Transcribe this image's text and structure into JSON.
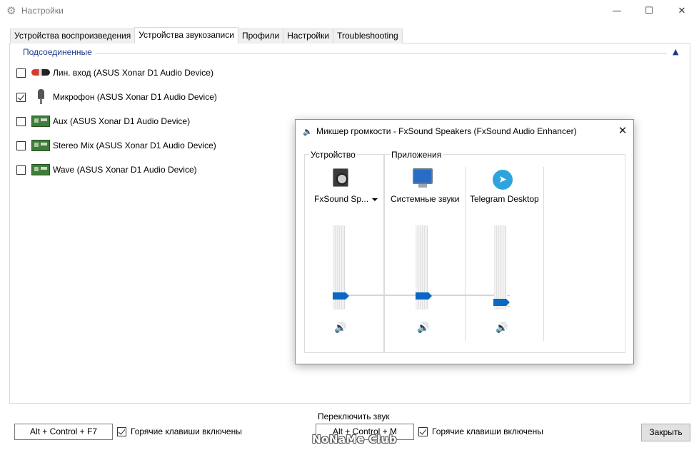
{
  "window": {
    "title": "Настройки",
    "icon": "gear-icon",
    "controls": {
      "minimize": "—",
      "maximize": "☐",
      "close": "✕"
    }
  },
  "tabs": [
    {
      "label": "Устройства воспроизведения",
      "active": false
    },
    {
      "label": "Устройства звукозаписи",
      "active": true
    },
    {
      "label": "Профили",
      "active": false
    },
    {
      "label": "Настройки",
      "active": false
    },
    {
      "label": "Troubleshooting",
      "active": false
    }
  ],
  "devices_group": {
    "header": "Подсоединенные",
    "collapse_glyph": "▲",
    "items": [
      {
        "label": "Лин. вход (ASUS Xonar D1 Audio Device)",
        "checked": false,
        "icon": "line-in-cable-icon"
      },
      {
        "label": "Микрофон (ASUS Xonar D1 Audio Device)",
        "checked": true,
        "icon": "microphone-icon"
      },
      {
        "label": "Aux (ASUS Xonar D1 Audio Device)",
        "checked": false,
        "icon": "sound-card-icon"
      },
      {
        "label": "Stereo Mix (ASUS Xonar D1 Audio Device)",
        "checked": false,
        "icon": "sound-card-icon"
      },
      {
        "label": "Wave (ASUS Xonar D1 Audio Device)",
        "checked": false,
        "icon": "sound-card-icon"
      }
    ]
  },
  "mixer": {
    "title": "Микшер громкости - FxSound Speakers (FxSound Audio Enhancer)",
    "close_glyph": "✕",
    "title_icon_glyph": "🔈",
    "device_group_label": "Устройство",
    "apps_group_label": "Приложения",
    "columns": [
      {
        "label": "FxSound Sp...",
        "icon": "speaker-icon",
        "volume_fraction": 0.3,
        "mute_glyph": "🔊"
      },
      {
        "label": "Системные звуки",
        "icon": "system-sounds-monitor-icon",
        "volume_fraction": 0.3,
        "mute_glyph": "🔊"
      },
      {
        "label": "Telegram Desktop",
        "icon": "telegram-icon",
        "volume_fraction": 0.25,
        "mute_glyph": "🔊"
      }
    ],
    "telegram_glyph": "➤"
  },
  "bottom": {
    "hotkey1": "Alt + Control + F7",
    "hotkeys1_enabled_label": "Горячие клавиши включены",
    "switch_sound_label": "Переключить звук",
    "hotkey2": "Alt + Control + M",
    "hotkeys2_enabled_label": "Горячие клавиши включены",
    "close_button": "Закрыть"
  },
  "watermark": "NoNaMe Club"
}
